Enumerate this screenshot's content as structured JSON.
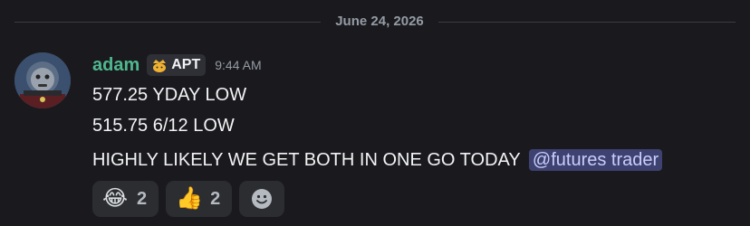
{
  "divider": {
    "date": "June 24, 2026"
  },
  "message": {
    "author": "adam",
    "author_color": "#4fb88f",
    "role_tag": {
      "icon": "crown-cat-icon",
      "label": "APT"
    },
    "timestamp": "9:44 AM",
    "lines": [
      "577.25 YDAY LOW",
      "515.75 6/12 LOW",
      "HIGHLY LIKELY WE GET BOTH IN ONE GO TODAY"
    ],
    "mention": "@futures trader",
    "reactions": [
      {
        "emoji": "😂",
        "icon": "tears-of-joy-icon",
        "count": "2"
      },
      {
        "emoji": "👍",
        "icon": "thumbs-up-icon",
        "count": "2"
      }
    ],
    "add_reaction_icon": "smiley-add-reaction-icon"
  },
  "colors": {
    "background": "#1a1a1e",
    "mention_bg": "#3d4270",
    "mention_text": "#c9cdfb",
    "timestamp": "#949ba4"
  }
}
